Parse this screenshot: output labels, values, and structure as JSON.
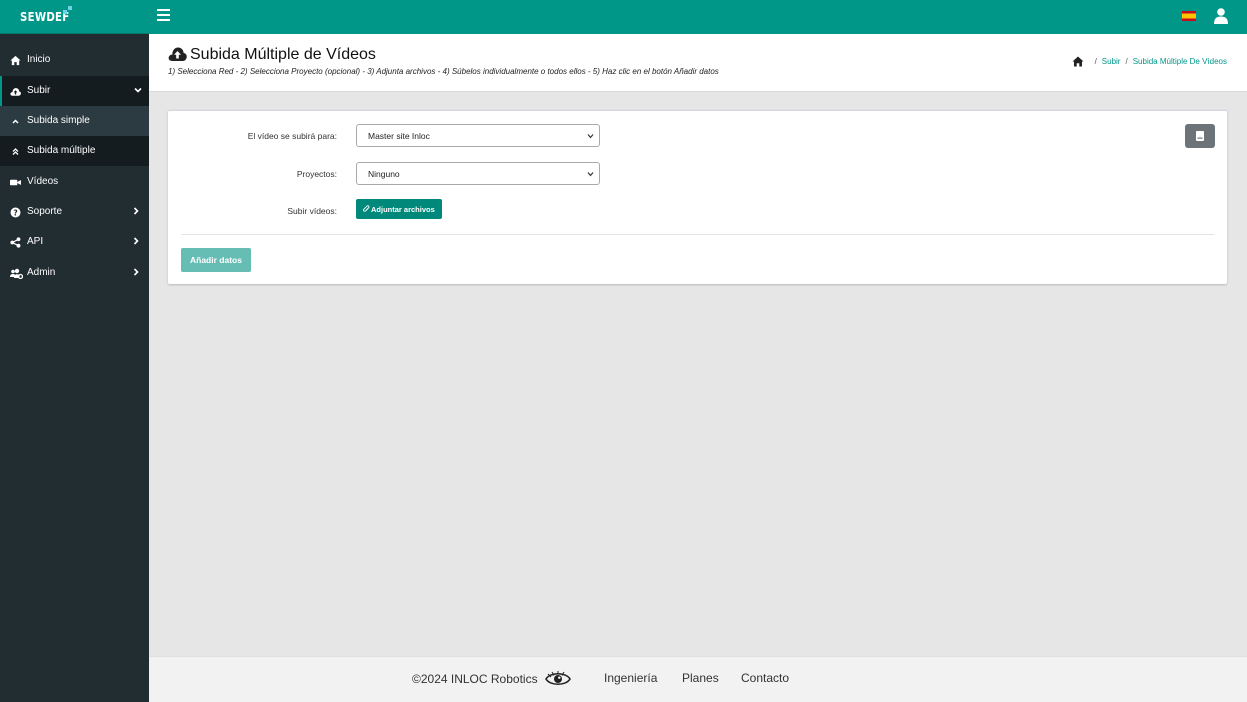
{
  "brand": {
    "name": "SEWDEF"
  },
  "sidebar": {
    "items": [
      {
        "label": "Inicio",
        "icon": "home-icon"
      },
      {
        "label": "Subir",
        "icon": "cloud-upload-icon"
      },
      {
        "label": "Subida simple",
        "icon": "chevron-up-icon"
      },
      {
        "label": "Subida múltiple",
        "icon": "double-chevron-up-icon"
      },
      {
        "label": "Vídeos",
        "icon": "video-camera-icon"
      },
      {
        "label": "Soporte",
        "icon": "question-circle-icon"
      },
      {
        "label": "API",
        "icon": "share-icon"
      },
      {
        "label": "Admin",
        "icon": "users-cog-icon"
      }
    ]
  },
  "header": {
    "title": "Subida Múltiple de Vídeos",
    "subtitle": "1) Selecciona Red - 2) Selecciona Proyecto (opcional) - 3) Adjunta archivos - 4) Súbelos individualmente o todos ellos - 5) Haz clic en el botón Añadir datos",
    "breadcrumb": {
      "subir": "Subir",
      "current": "Subida Múltiple De Vídeos"
    }
  },
  "form": {
    "network_label": "El vídeo se subirá para:",
    "network_value": "Master site Inloc",
    "project_label": "Proyectos:",
    "project_value": "Ninguno",
    "upload_label": "Subir vídeos:",
    "attach_button": "Adjuntar archivos",
    "add_button": "Añadir datos"
  },
  "footer": {
    "copyright": "©2024 INLOC Robotics",
    "links": [
      "Ingeniería",
      "Planes",
      "Contacto"
    ]
  },
  "colors": {
    "primary": "#009688",
    "sidebar_bg": "#222d32",
    "add_button": "#66bdb4",
    "attach_button": "#00897b"
  }
}
